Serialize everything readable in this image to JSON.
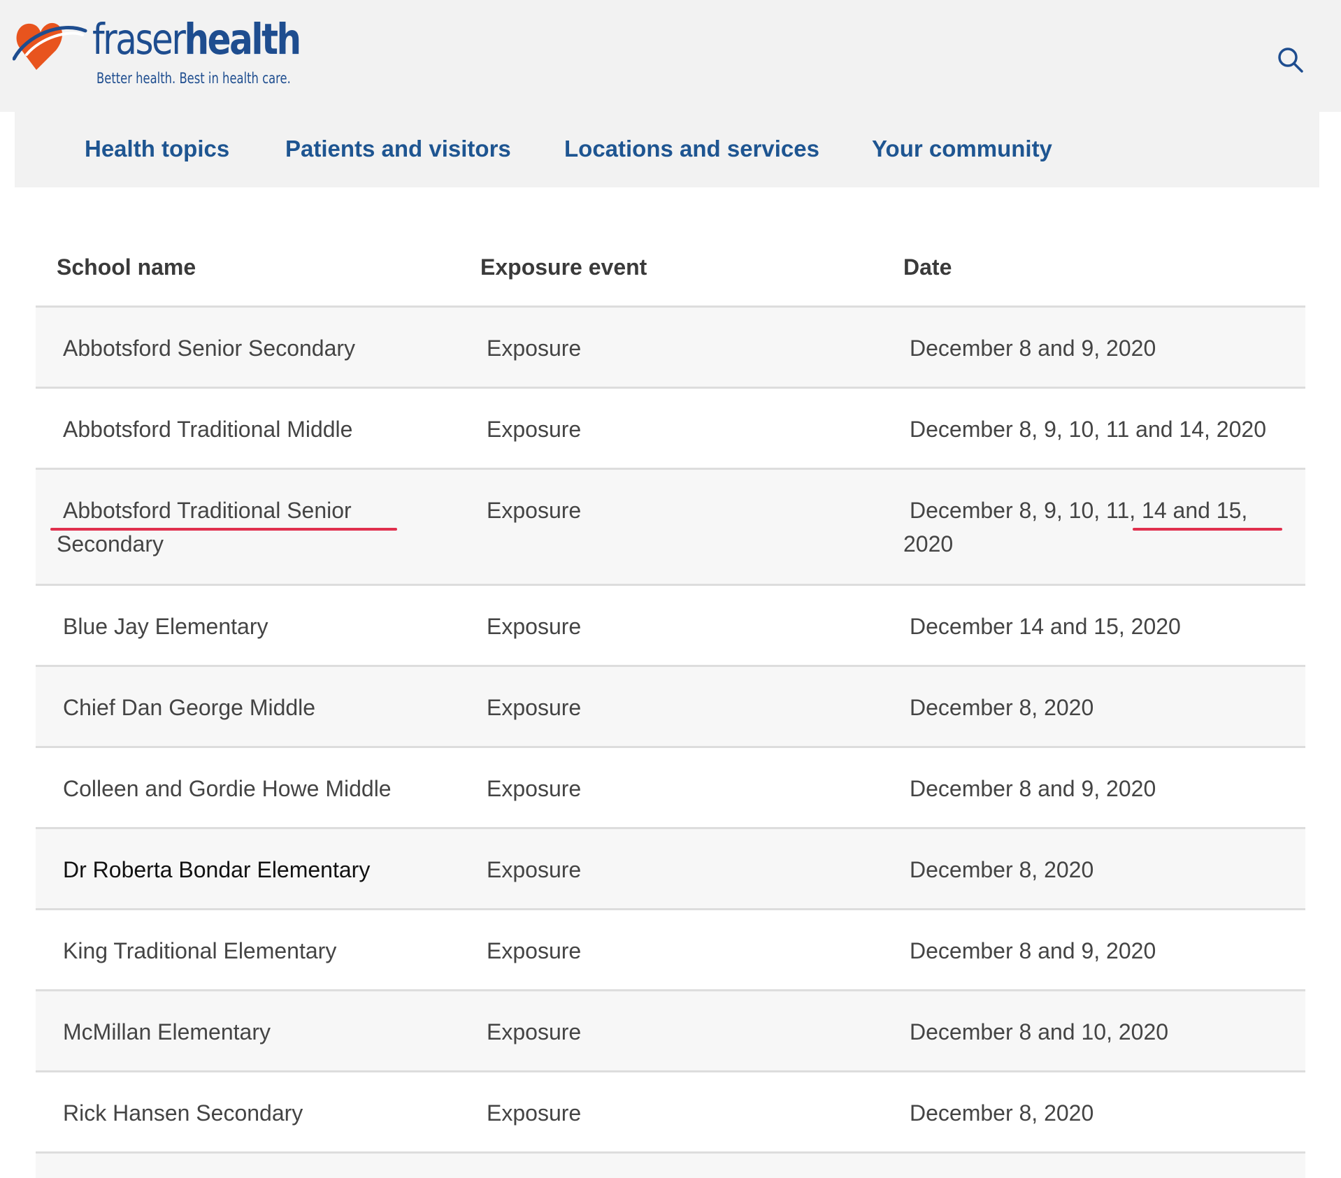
{
  "header": {
    "brand_light": "fraser",
    "brand_bold": "health",
    "tagline": "Better health. Best in health care.",
    "search_icon": "search-icon",
    "brand_color": "#1e4d8f",
    "logo_accent": "#e8541e"
  },
  "nav": {
    "items": [
      {
        "label": "Health topics"
      },
      {
        "label": "Patients and visitors"
      },
      {
        "label": "Locations and services"
      },
      {
        "label": "Your community"
      }
    ]
  },
  "table": {
    "headers": {
      "school": "School name",
      "event": "Exposure event",
      "date": "Date"
    },
    "rows": [
      {
        "school": "Abbotsford Senior Secondary",
        "event": "Exposure",
        "date": "December 8 and 9, 2020"
      },
      {
        "school": "Abbotsford Traditional Middle",
        "event": "Exposure",
        "date": "December 8, 9, 10, 11 and 14,  2020"
      },
      {
        "school_line1": "Abbotsford Traditional Senior",
        "school_line2": "Secondary",
        "event": "Exposure",
        "date_line1": "December 8, 9, 10, 11, 14 and 15,",
        "date_line2": "2020"
      },
      {
        "school": "Blue Jay Elementary",
        "event": "Exposure",
        "date": "December 14 and 15, 2020"
      },
      {
        "school": "Chief Dan George Middle",
        "event": "Exposure",
        "date": "December 8, 2020"
      },
      {
        "school": "Colleen and Gordie Howe Middle",
        "event": "Exposure",
        "date": "December 8 and 9, 2020"
      },
      {
        "school": "Dr Roberta Bondar Elementary",
        "event": "Exposure",
        "date": "December 8, 2020"
      },
      {
        "school": "King Traditional Elementary",
        "event": "Exposure",
        "date": "December 8 and 9, 2020"
      },
      {
        "school": "McMillan Elementary",
        "event": "Exposure",
        "date": "December 8 and 10, 2020"
      },
      {
        "school": "Rick Hansen Secondary",
        "event": "Exposure",
        "date": "December 8, 2020"
      }
    ]
  },
  "annotation_color": "#e0304e"
}
